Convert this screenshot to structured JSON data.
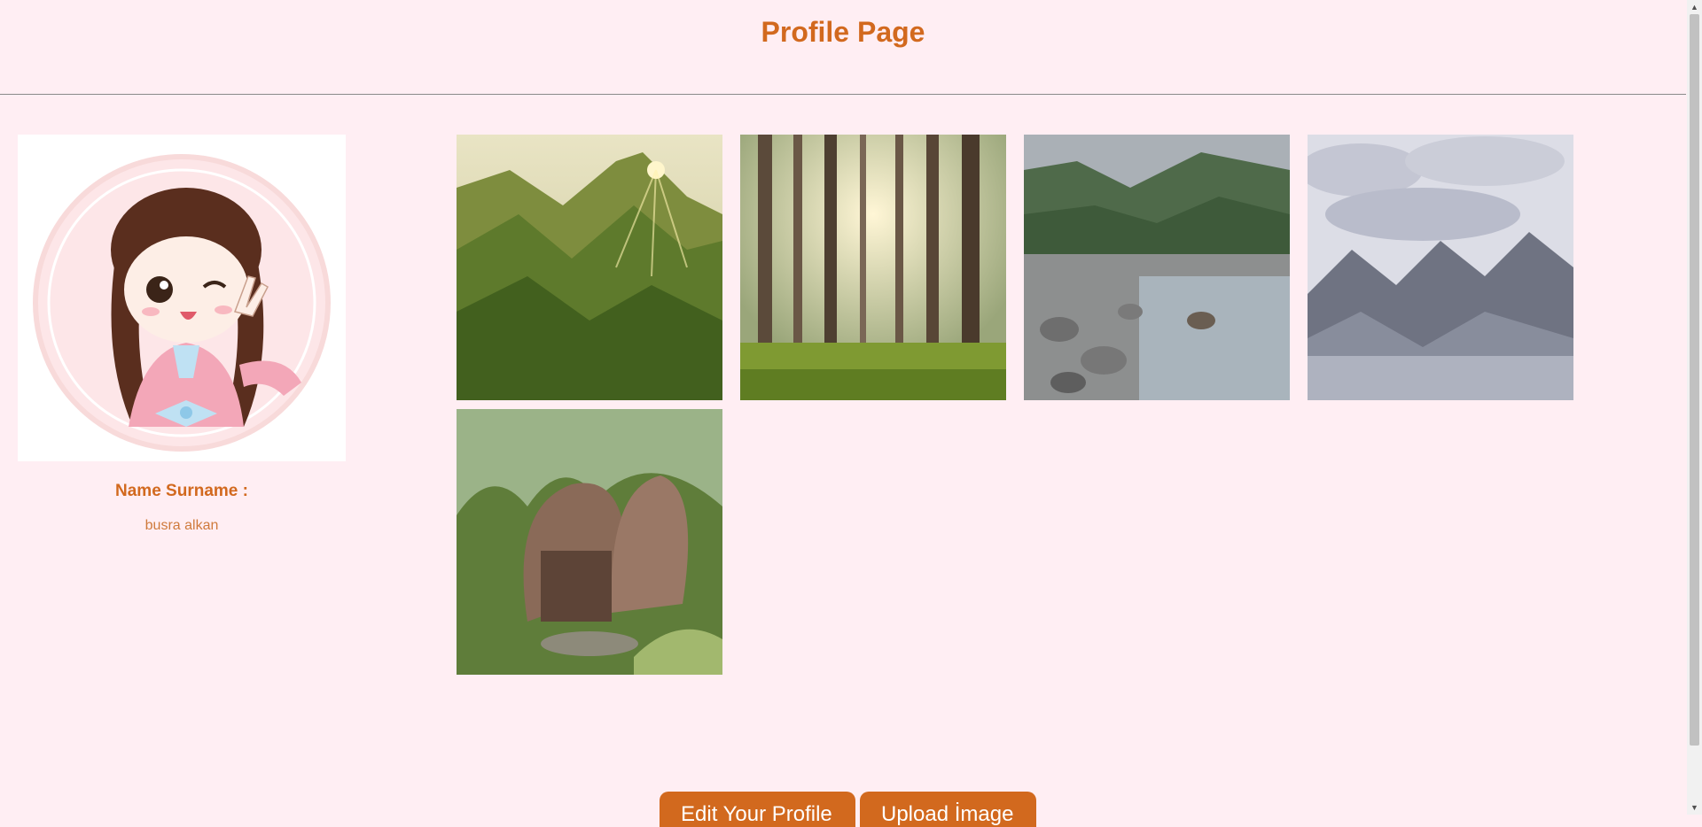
{
  "header": {
    "title": "Profile Page"
  },
  "profile": {
    "name_label": "Name Surname :",
    "name_value": "busra alkan"
  },
  "gallery": {
    "images": [
      {
        "subject": "sunlit green mountains"
      },
      {
        "subject": "pine forest with sunbeams"
      },
      {
        "subject": "rocky river under misty hills"
      },
      {
        "subject": "foggy mountain peaks"
      },
      {
        "subject": "curved wooden house in jungle"
      }
    ]
  },
  "actions": {
    "edit_label": "Edit Your Profile",
    "upload_label": "Upload İmage"
  },
  "colors": {
    "accent": "#d2691e",
    "background": "#ffeef3"
  }
}
